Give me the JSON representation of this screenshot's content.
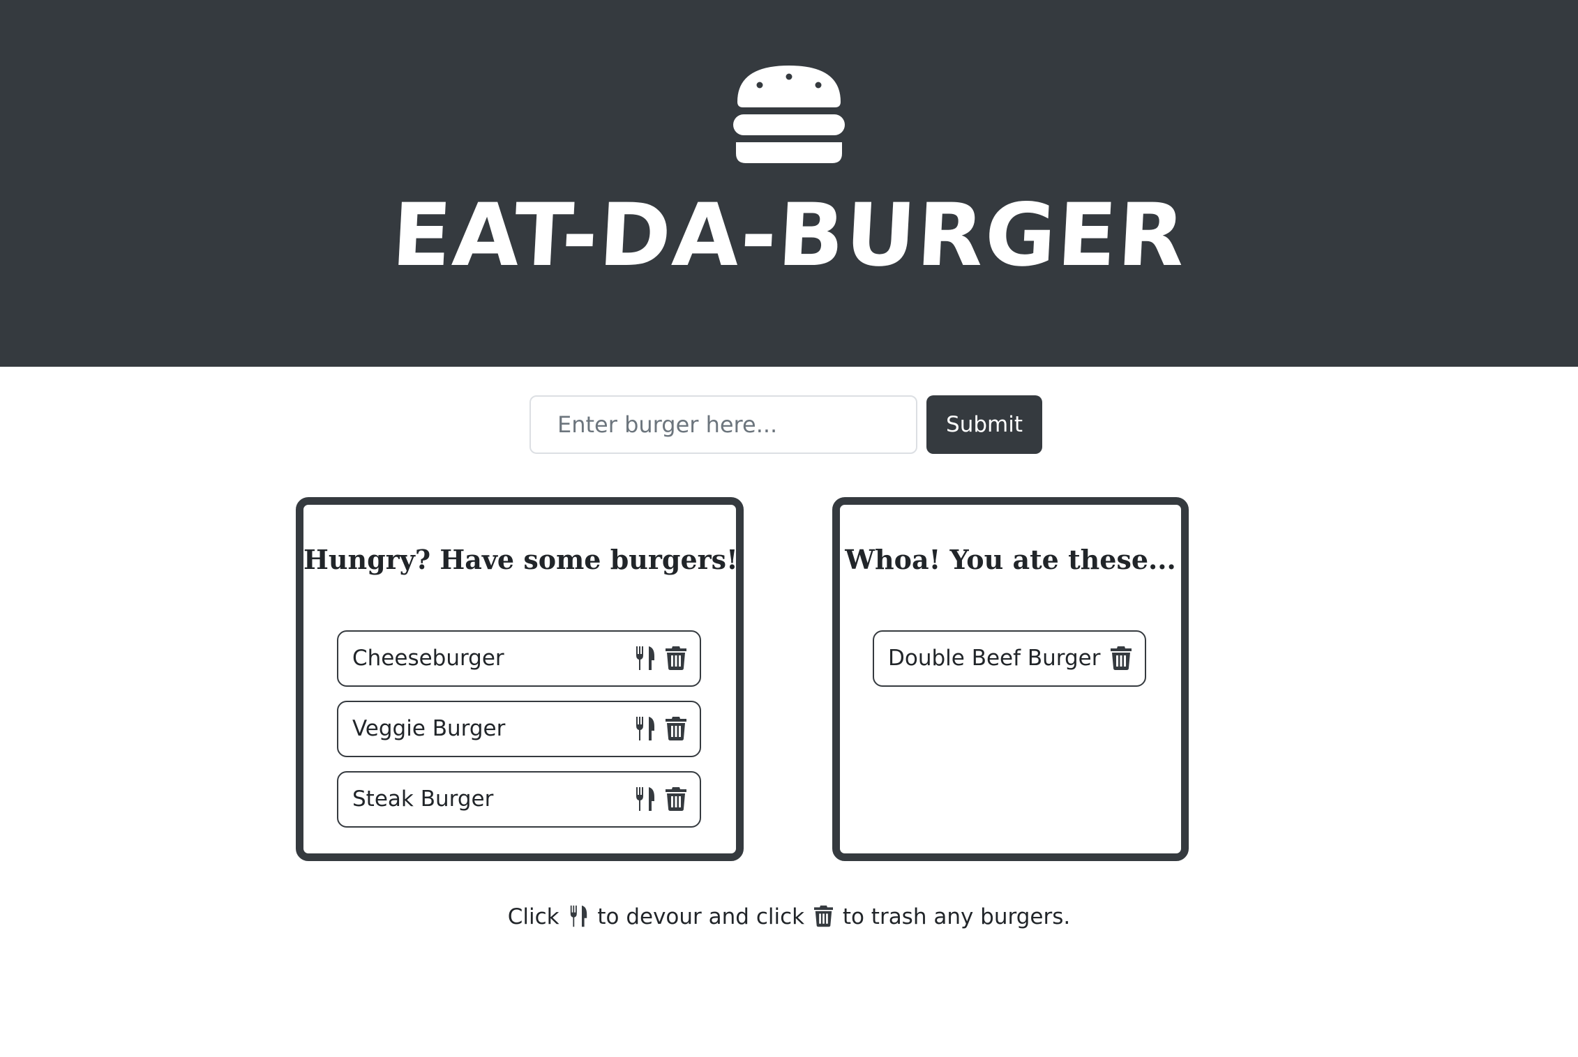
{
  "header": {
    "logo_icon": "hamburger-icon",
    "title": "EAT-DA-BURGER",
    "background_color": "#353a3f"
  },
  "form": {
    "placeholder": "Enter burger here...",
    "value": "",
    "submit_label": "Submit"
  },
  "uneaten": {
    "heading": "Hungry? Have some burgers!",
    "items": [
      {
        "name": "Cheeseburger"
      },
      {
        "name": "Veggie Burger"
      },
      {
        "name": "Steak Burger"
      }
    ],
    "item_icons": [
      "utensils-icon",
      "trash-icon"
    ]
  },
  "devoured": {
    "heading": "Whoa! You ate these...",
    "items": [
      {
        "name": "Double Beef Burger"
      }
    ],
    "item_icons": [
      "trash-icon"
    ]
  },
  "instructions": {
    "part1": "Click",
    "part2": "to devour and click",
    "part3": "to trash any burgers."
  },
  "colors": {
    "dark": "#353a3f",
    "text": "#212529",
    "placeholder": "#6c757d"
  }
}
